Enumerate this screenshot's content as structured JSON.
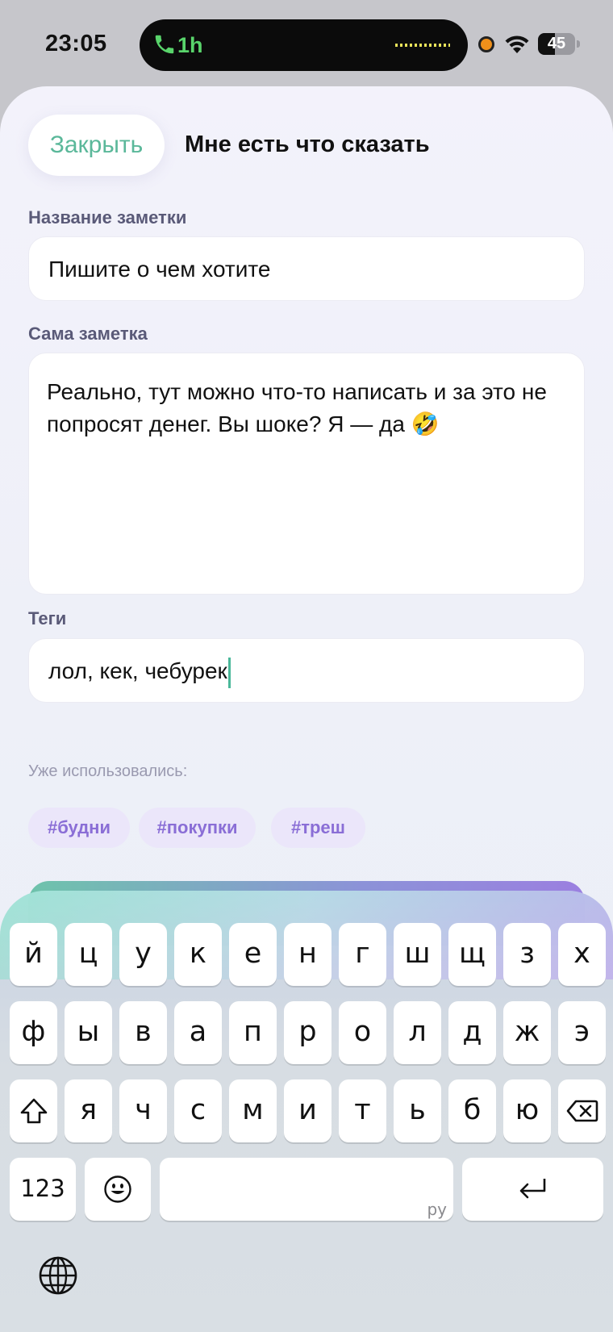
{
  "status_bar": {
    "time": "23:05",
    "call_duration": "1h",
    "battery_percent": "45",
    "battery_level": 0.45,
    "icons": [
      "phone-icon",
      "recording-dot-icon",
      "wifi-icon",
      "battery-icon"
    ]
  },
  "sheet": {
    "close_label": "Закрыть",
    "title": "Мне есть что сказать"
  },
  "form": {
    "note_title_label": "Название заметки",
    "note_title_placeholder": "Пишите о чем хотите",
    "note_body_label": "Сама заметка",
    "note_body_value": "Реально, тут можно что-то написать и за это не попросят денег. Вы шоке? Я — да 🤣",
    "tags_label": "Теги",
    "tags_value": "лол, кек, чебурек",
    "used_label": "Уже использовались:",
    "used_tags": [
      "#будни",
      "#покупки",
      "#треш"
    ]
  },
  "keyboard": {
    "row1": [
      "й",
      "ц",
      "у",
      "к",
      "е",
      "н",
      "г",
      "ш",
      "щ",
      "з",
      "х"
    ],
    "row2": [
      "ф",
      "ы",
      "в",
      "а",
      "п",
      "р",
      "о",
      "л",
      "д",
      "ж",
      "э"
    ],
    "row3": [
      "я",
      "ч",
      "с",
      "м",
      "и",
      "т",
      "ь",
      "б",
      "ю"
    ],
    "numbers_label": "123",
    "space_hint": "ру",
    "icons": [
      "shift-icon",
      "backspace-icon",
      "emoji-icon",
      "return-icon",
      "globe-icon"
    ]
  },
  "colors": {
    "accent_green": "#5bb89a",
    "chip_text": "#8a6ed6",
    "chip_bg": "#ebe6fa"
  }
}
